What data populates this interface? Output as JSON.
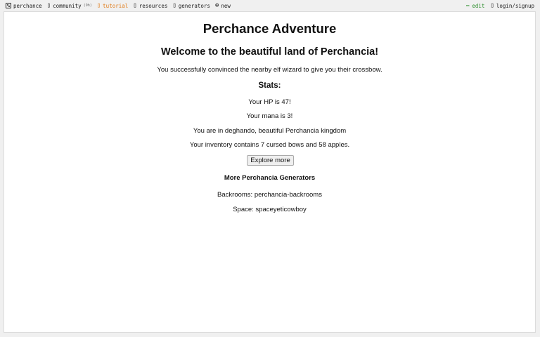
{
  "topbar": {
    "nav": [
      {
        "label": "perchance",
        "icon": "dice-icon"
      },
      {
        "label": "community",
        "count": "(9h)",
        "icon": "community-icon"
      },
      {
        "label": "tutorial",
        "icon": "tutorial-icon"
      },
      {
        "label": "resources",
        "icon": "resources-icon"
      },
      {
        "label": "generators",
        "icon": "generators-icon"
      },
      {
        "label": "new",
        "icon": "plus-circle-icon"
      }
    ],
    "edit_label": "edit",
    "login_label": "login/signup",
    "active_color": "#e07c1a",
    "edit_color": "#2f8f2f"
  },
  "main": {
    "title": "Perchance Adventure",
    "welcome": "Welcome to the beautiful land of Perchancia!",
    "event": "You successfully convinced the nearby elf wizard to give you their crossbow.",
    "stats_heading": "Stats:",
    "hp": "Your HP is 47!",
    "mana": "Your mana is 3!",
    "location": "You are in deghando, beautiful Perchancia kingdom",
    "inventory": "Your inventory contains 7 cursed bows and 58 apples.",
    "explore_button": "Explore more",
    "more_heading": "More Perchancia Generators",
    "generators": [
      {
        "prefix": "Backrooms: ",
        "link": "perchancia-backrooms"
      },
      {
        "prefix": "Space: ",
        "link": "spaceyeticowboy"
      }
    ]
  }
}
